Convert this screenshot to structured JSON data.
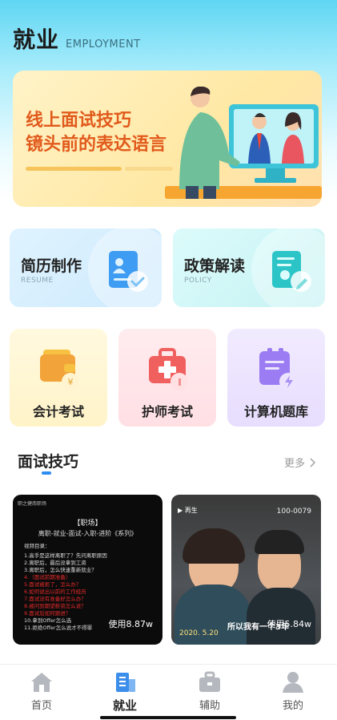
{
  "header": {
    "title": "就业",
    "subtitle": "EMPLOYMENT"
  },
  "banner": {
    "line1": "线上面试技巧",
    "line2": "镜头前的表达语言"
  },
  "features": [
    {
      "title": "简历制作",
      "subtitle": "RESUME",
      "icon": "resume-document-icon"
    },
    {
      "title": "政策解读",
      "subtitle": "POLICY",
      "icon": "policy-document-icon"
    }
  ],
  "exams": [
    {
      "label": "会计考试",
      "icon": "wallet-yen-icon"
    },
    {
      "label": "护师考试",
      "icon": "medical-kit-icon"
    },
    {
      "label": "计算机题库",
      "icon": "clipboard-lightning-icon"
    }
  ],
  "section": {
    "title": "面试技巧",
    "more": "更多"
  },
  "videos": [
    {
      "brand": "职之健南职场",
      "tag": "【职场】",
      "subtitle": "离职-就业-面试-入职-进阶《系列》",
      "intro": "视频目录：",
      "lines": [
        "1.高手是这样离职了？先问离职原因",
        "2.离职后，最后没拿到工资",
        "3.离职后，怎么快速重新就业？",
        "4.（面试前期准备）",
        "5.面试被拒了，怎么办？",
        "6.如何说出以前的工作经历",
        "7.面试没有准备好怎么办？",
        "8.被问到期望薪资怎么说？",
        "9.面试后如何跟进？",
        "10.拿到Offer怎么选",
        "11.拒绝Offer怎么说才不得罪"
      ],
      "views": "使用8.87w"
    },
    {
      "play_label": "再生",
      "code": "100-0079",
      "caption": "所以我有一个3年",
      "date": "2020. 5.20",
      "views": "使用5.84w"
    }
  ],
  "tabs": [
    {
      "label": "首页",
      "icon": "home-icon"
    },
    {
      "label": "就业",
      "icon": "employment-building-icon"
    },
    {
      "label": "辅助",
      "icon": "briefcase-icon"
    },
    {
      "label": "我的",
      "icon": "user-icon"
    }
  ],
  "active_tab": "就业",
  "colors": {
    "accent": "#2f8cf0",
    "banner_text": "#e15a1c"
  }
}
